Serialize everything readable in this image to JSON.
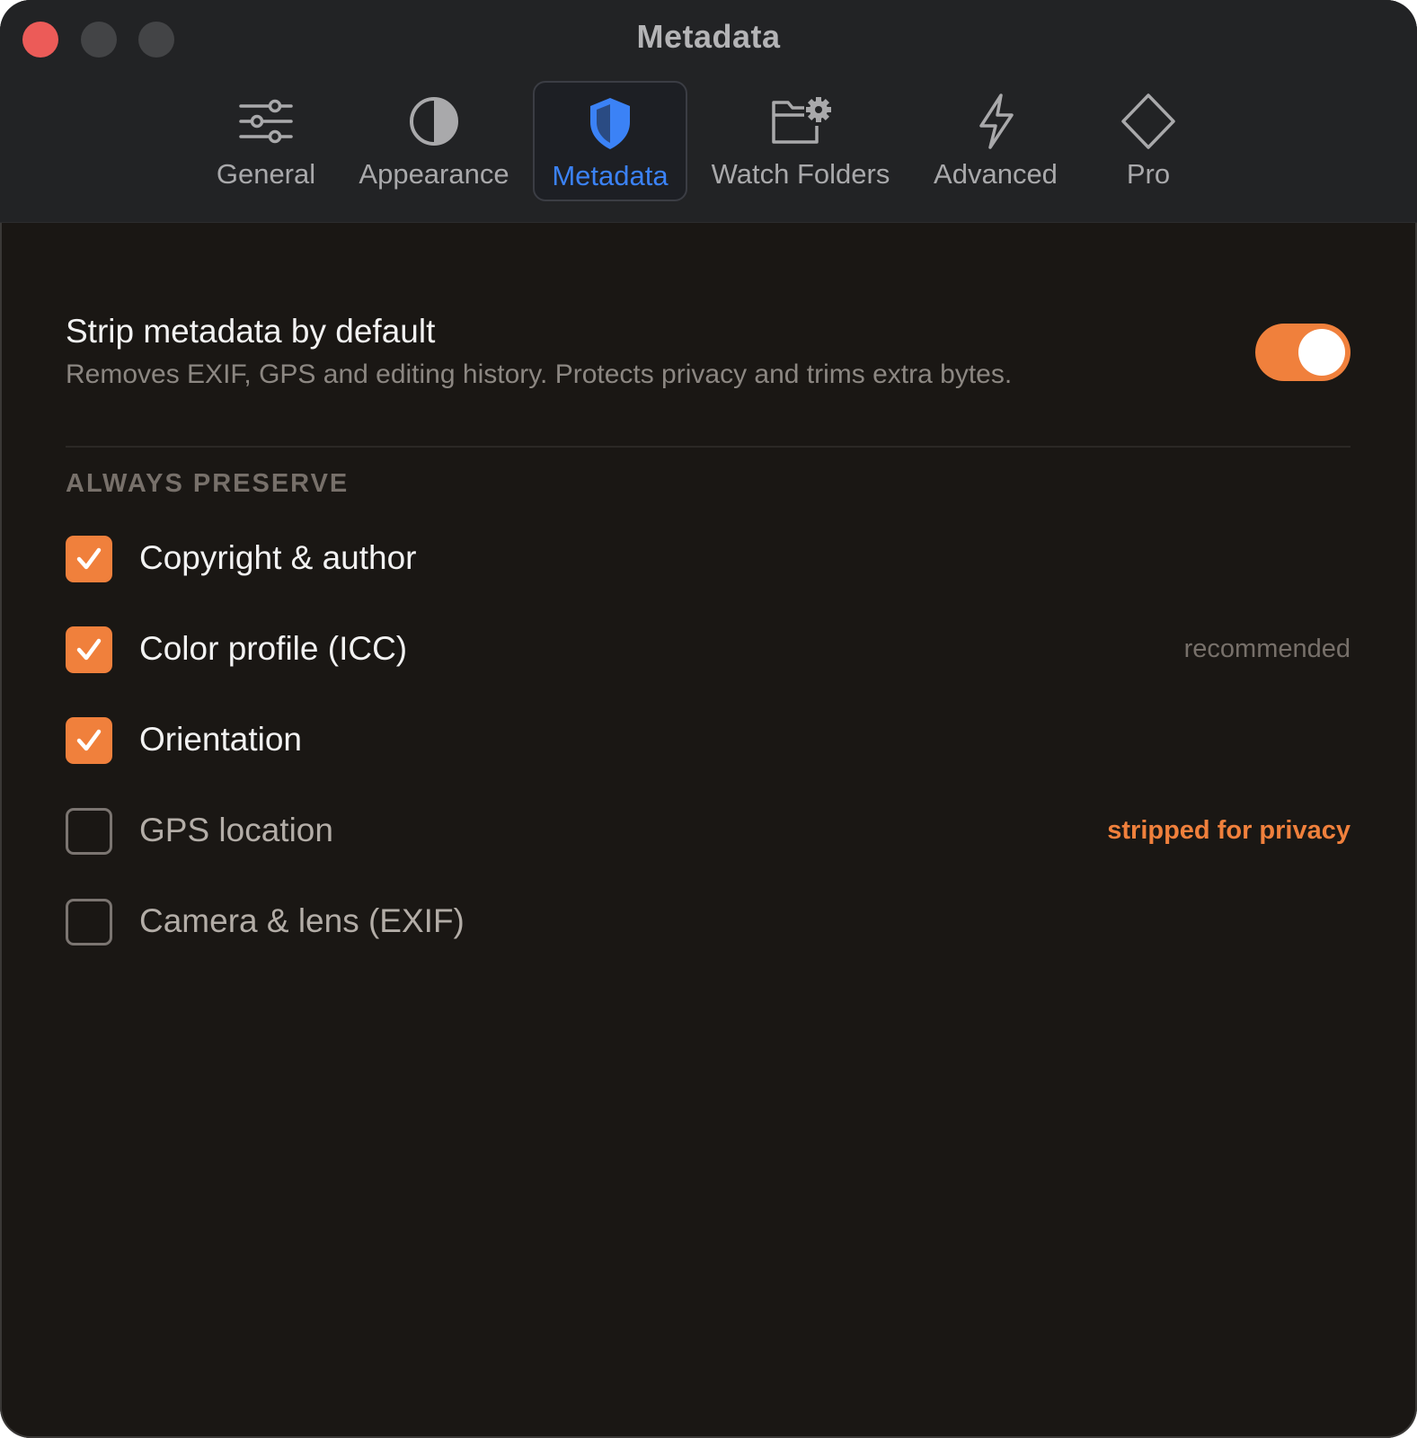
{
  "window": {
    "title": "Metadata"
  },
  "tabs": [
    {
      "label": "General",
      "icon": "sliders-icon",
      "active": false
    },
    {
      "label": "Appearance",
      "icon": "half-circle-icon",
      "active": false
    },
    {
      "label": "Metadata",
      "icon": "shield-icon",
      "active": true
    },
    {
      "label": "Watch Folders",
      "icon": "folder-gear-icon",
      "active": false
    },
    {
      "label": "Advanced",
      "icon": "bolt-icon",
      "active": false
    },
    {
      "label": "Pro",
      "icon": "diamond-icon",
      "active": false
    }
  ],
  "strip": {
    "title": "Strip metadata by default",
    "description": "Removes EXIF, GPS and editing history. Protects privacy and trims extra bytes.",
    "enabled": true
  },
  "preserve": {
    "heading": "ALWAYS PRESERVE",
    "options": [
      {
        "label": "Copyright & author",
        "checked": true,
        "note": ""
      },
      {
        "label": "Color profile (ICC)",
        "checked": true,
        "note": "recommended"
      },
      {
        "label": "Orientation",
        "checked": true,
        "note": ""
      },
      {
        "label": "GPS location",
        "checked": false,
        "note": "stripped for privacy"
      },
      {
        "label": "Camera & lens (EXIF)",
        "checked": false,
        "note": ""
      }
    ]
  },
  "colors": {
    "accent": "#f0803c",
    "active_tab": "#3b82f6",
    "background": "#1a1714",
    "titlebar": "#222325",
    "close_button": "#ec5b58"
  }
}
